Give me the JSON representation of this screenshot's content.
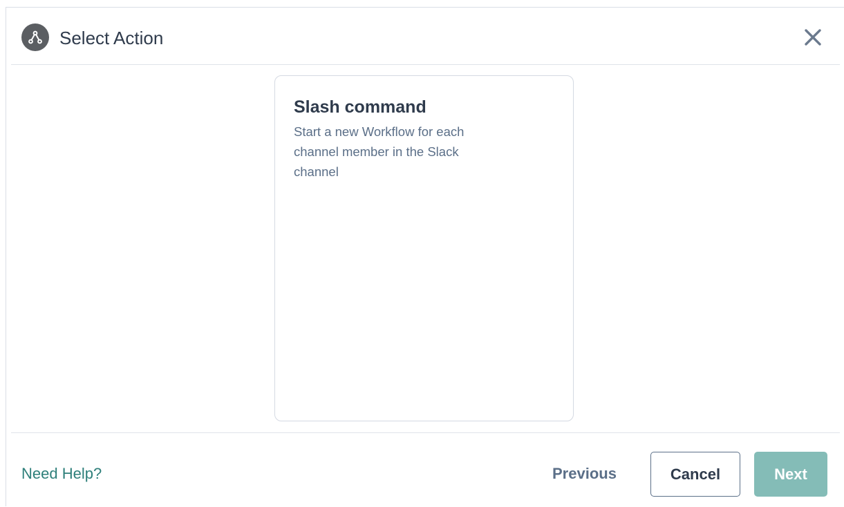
{
  "dialog": {
    "title": "Select Action",
    "header_icon": "workflow-nodes-icon",
    "close_icon": "close-icon"
  },
  "card": {
    "title": "Slash command",
    "description": "Start a new Workflow for each channel member in the Slack channel"
  },
  "footer": {
    "help_label": "Need Help?",
    "previous_label": "Previous",
    "cancel_label": "Cancel",
    "next_label": "Next"
  },
  "colors": {
    "accent_teal": "#2e7f7a",
    "next_button_disabled": "#84bcb7",
    "header_icon_bg": "#5b5e62",
    "title_text": "#2f3b4c",
    "muted_text": "#5b6f88"
  }
}
